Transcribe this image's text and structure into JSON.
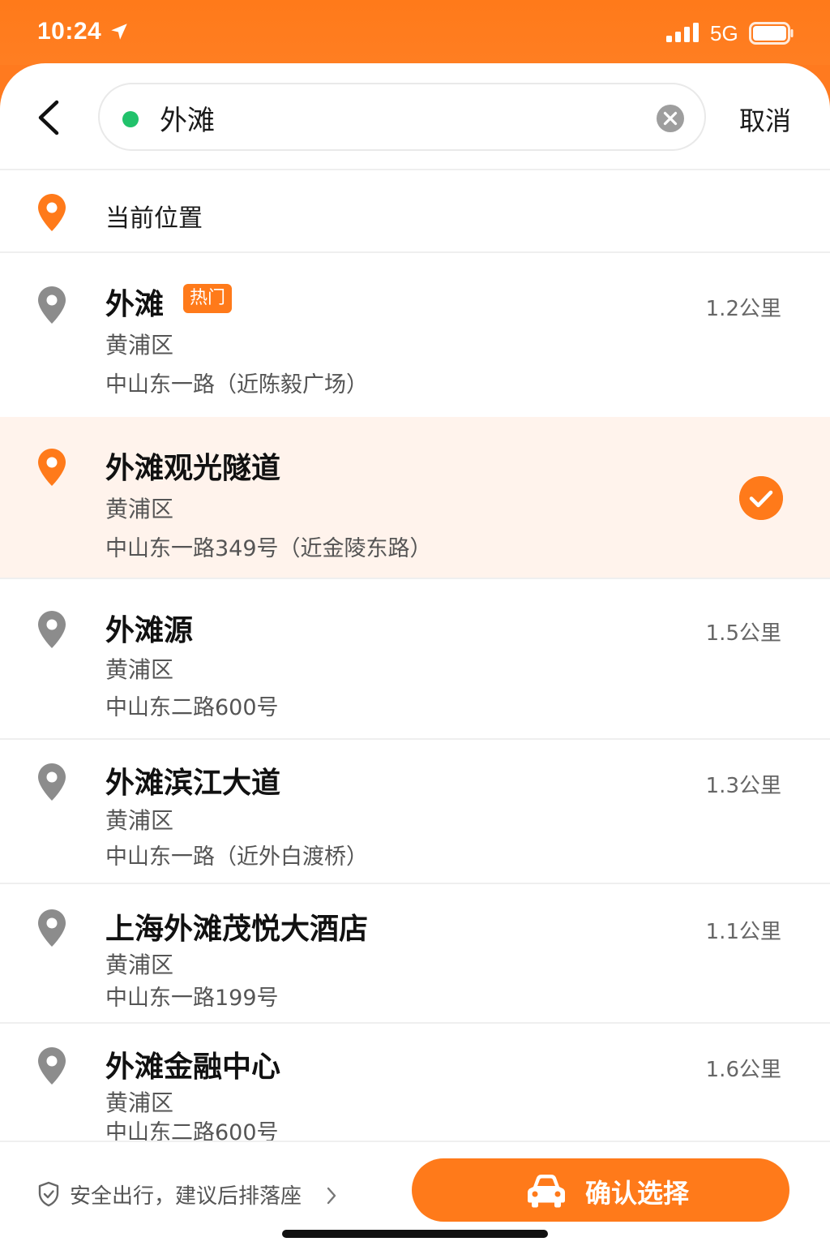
{
  "status_bar": {
    "time": "10:24",
    "network": "5G"
  },
  "search": {
    "value": "外滩",
    "cancel_label": "取消"
  },
  "current_location": {
    "label": "当前位置"
  },
  "results": [
    {
      "title": "外滩",
      "badge": "热门",
      "district": "黄浦区",
      "address": "中山东一路（近陈毅广场）",
      "distance": "1.2公里",
      "selected": false
    },
    {
      "title": "外滩观光隧道",
      "district": "黄浦区",
      "address": "中山东一路349号（近金陵东路）",
      "distance": "",
      "selected": true
    },
    {
      "title": "外滩源",
      "district": "黄浦区",
      "address": "中山东二路600号",
      "distance": "1.5公里",
      "selected": false
    },
    {
      "title": "外滩滨江大道",
      "district": "黄浦区",
      "address": "中山东一路（近外白渡桥）",
      "distance": "1.3公里",
      "selected": false
    },
    {
      "title": "上海外滩茂悦大酒店",
      "district": "黄浦区",
      "address": "中山东一路199号",
      "distance": "1.1公里",
      "selected": false
    },
    {
      "title": "外滩金融中心",
      "district": "黄浦区",
      "address": "中山东二路600号",
      "distance": "1.6公里",
      "selected": false
    }
  ],
  "bottom": {
    "safety_text": "安全出行，建议后排落座",
    "confirm_label": "确认选择"
  },
  "colors": {
    "accent": "#ff7a1a",
    "selected_bg": "#fff3ec",
    "green_dot": "#21c26b",
    "pin_gray": "#8c8c8c"
  },
  "icons": [
    "location-arrow-icon",
    "signal-icon",
    "battery-icon",
    "back-chevron-icon",
    "clear-icon",
    "pin-icon",
    "check-icon",
    "shield-icon",
    "chevron-right-icon",
    "car-icon"
  ]
}
